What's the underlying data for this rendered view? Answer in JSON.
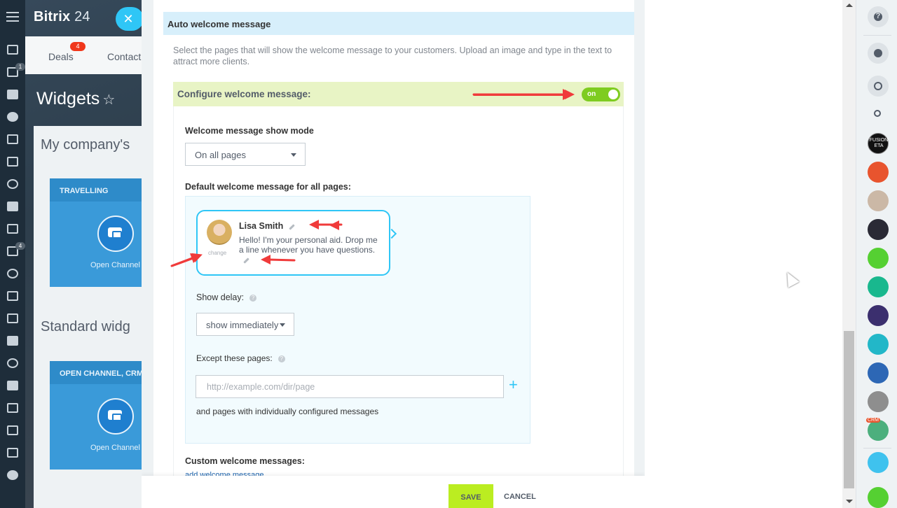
{
  "app": {
    "logo": "Bitrix",
    "logo_num": "24"
  },
  "left_rail": {
    "badge_tasks": "1",
    "badge_filter": "4"
  },
  "background": {
    "tabs": [
      {
        "label": "Deals",
        "badge": "4"
      },
      {
        "label": "Contact"
      }
    ],
    "page_title": "Widgets",
    "section1": "My company's",
    "section2": "Standard widg",
    "tile1": {
      "header": "TRAVELLING",
      "label": "Open Channel"
    },
    "tile2": {
      "header": "OPEN CHANNEL, CRM F",
      "label": "Open Channel"
    }
  },
  "panel": {
    "section_title": "Auto welcome message",
    "description": "Select the pages that will show the welcome message to your customers. Upload an image and type in the text to attract more clients.",
    "configure_label": "Configure welcome message:",
    "toggle_label": "on",
    "toggle_on": true,
    "show_mode_label": "Welcome message show mode",
    "show_mode_value": "On all pages",
    "default_label": "Default welcome message for all pages:",
    "agent": {
      "name": "Lisa Smith",
      "message": "Hello! I'm your personal aid. Drop me a line whenever you have questions.",
      "change_label": "change"
    },
    "show_delay_label": "Show delay:",
    "show_delay_value": "show immediately",
    "except_label": "Except these pages:",
    "url_placeholder": "http://example.com/dir/page",
    "url_value": "",
    "plus_label": "+",
    "individual_note": "and pages with individually configured messages",
    "custom_label": "Custom welcome messages:",
    "add_link": "add welcome message",
    "save_label": "SAVE",
    "cancel_label": "CANCEL"
  },
  "right_sidebar": {
    "help": "?",
    "avatar_text": "FUSION ETA",
    "crm_badge": "CRM"
  },
  "colors": {
    "accent": "#2fc6f6",
    "toggle": "#7ecc20",
    "save": "#bbed21",
    "annotation_arrow": "#f03b3b",
    "config_bar": "#e8f4c5",
    "header_bar": "#d7effb"
  }
}
